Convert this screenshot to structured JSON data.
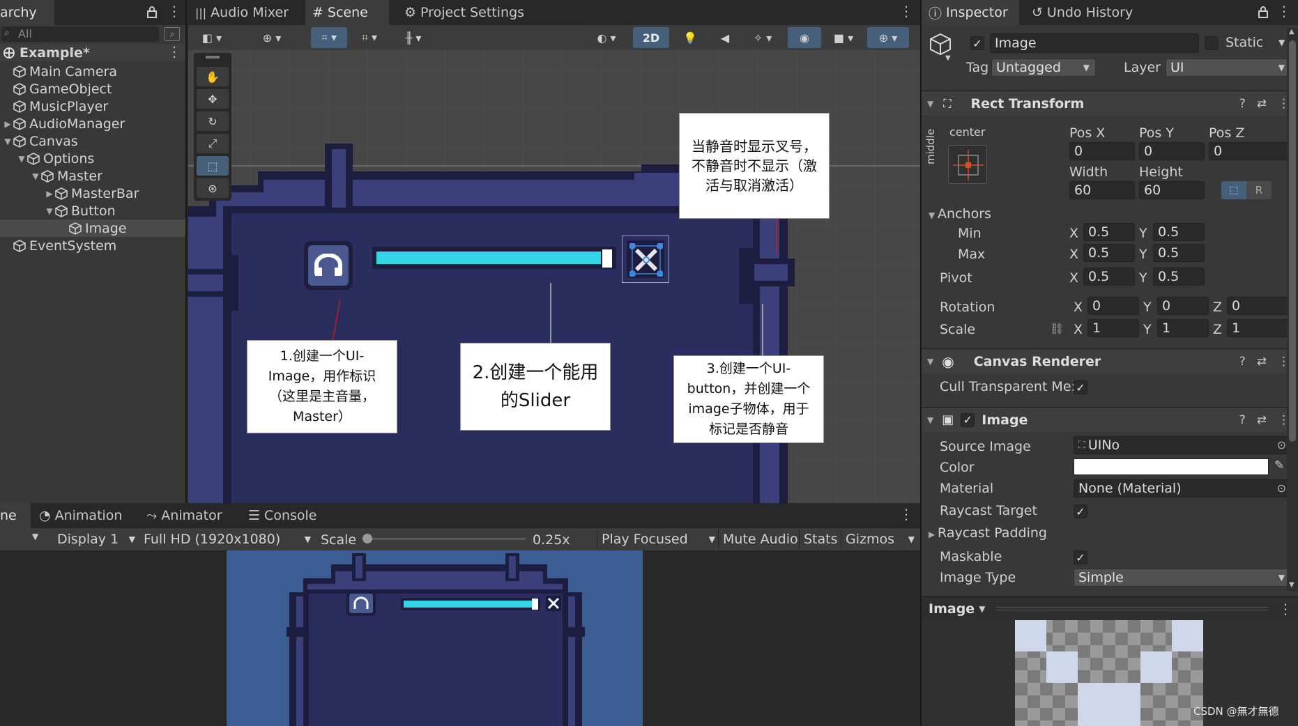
{
  "hierarchy": {
    "tab_label": "archy",
    "search_placeholder": "All",
    "scene_name": "Example*",
    "items": [
      {
        "label": "Main Camera"
      },
      {
        "label": "GameObject"
      },
      {
        "label": "MusicPlayer"
      },
      {
        "label": "AudioManager"
      },
      {
        "label": "Canvas"
      },
      {
        "label": "Options"
      },
      {
        "label": "Master"
      },
      {
        "label": "MasterBar"
      },
      {
        "label": "Button"
      },
      {
        "label": "Image"
      },
      {
        "label": "EventSystem"
      }
    ]
  },
  "center_tabs": [
    {
      "label": "Audio Mixer"
    },
    {
      "label": "Scene"
    },
    {
      "label": "Project Settings"
    }
  ],
  "scene_toolbar": {
    "mode_2d": "2D"
  },
  "callouts": {
    "mute": "当静音时显示叉号，不静音时不显示（激活与取消激活）",
    "image": "1.创建一个UI-Image，用作标识（这里是主音量，Master）",
    "slider": "2.创建一个能用的Slider",
    "button": "3.创建一个UI-button，并创建一个image子物体，用于标记是否静音"
  },
  "bottom_tabs": [
    {
      "label": "ne"
    },
    {
      "label": "Animation"
    },
    {
      "label": "Animator"
    },
    {
      "label": "Console"
    }
  ],
  "game_toolbar": {
    "display": "Display 1",
    "resolution": "Full HD (1920x1080)",
    "scale_label": "Scale",
    "scale_value": "0.25x",
    "play_mode": "Play Focused",
    "mute": "Mute Audio",
    "stats": "Stats",
    "gizmos": "Gizmos"
  },
  "inspector": {
    "tabs": [
      {
        "label": "Inspector"
      },
      {
        "label": "Undo History"
      }
    ],
    "object_name": "Image",
    "static_label": "Static",
    "tag_label": "Tag",
    "tag_value": "Untagged",
    "layer_label": "Layer",
    "layer_value": "UI",
    "rect_transform": {
      "title": "Rect Transform",
      "anchor_h": "center",
      "anchor_v": "middle",
      "pos_x_label": "Pos X",
      "pos_y_label": "Pos Y",
      "pos_z_label": "Pos Z",
      "pos_x": "0",
      "pos_y": "0",
      "pos_z": "0",
      "width_label": "Width",
      "height_label": "Height",
      "width": "60",
      "height": "60",
      "r_label": "R",
      "anchors_label": "Anchors",
      "min_label": "Min",
      "max_label": "Max",
      "pivot_label": "Pivot",
      "x": "X",
      "y": "Y",
      "z": "Z",
      "min_x": "0.5",
      "min_y": "0.5",
      "max_x": "0.5",
      "max_y": "0.5",
      "pivot_x": "0.5",
      "pivot_y": "0.5",
      "rotation_label": "Rotation",
      "rot_x": "0",
      "rot_y": "0",
      "rot_z": "0",
      "scale_label": "Scale",
      "scale_x": "1",
      "scale_y": "1",
      "scale_z": "1"
    },
    "canvas_renderer": {
      "title": "Canvas Renderer",
      "cull_label": "Cull Transparent Me:"
    },
    "image": {
      "title": "Image",
      "source_label": "Source Image",
      "source_value": "UINo",
      "color_label": "Color",
      "material_label": "Material",
      "material_value": "None (Material)",
      "raycast_label": "Raycast Target",
      "padding_label": "Raycast Padding",
      "maskable_label": "Maskable",
      "type_label": "Image Type",
      "type_value": "Simple"
    },
    "preview_label": "Image"
  },
  "watermark": "CSDN @無才無德",
  "colors": {
    "slider_fill": "#32d6e6",
    "frame_dark": "#1d1d3f",
    "frame_mid": "#3b3f7a",
    "frame_inner": "#2b2d5e",
    "game_bg": "#3c5c94",
    "accent": "#4a7ec8"
  }
}
